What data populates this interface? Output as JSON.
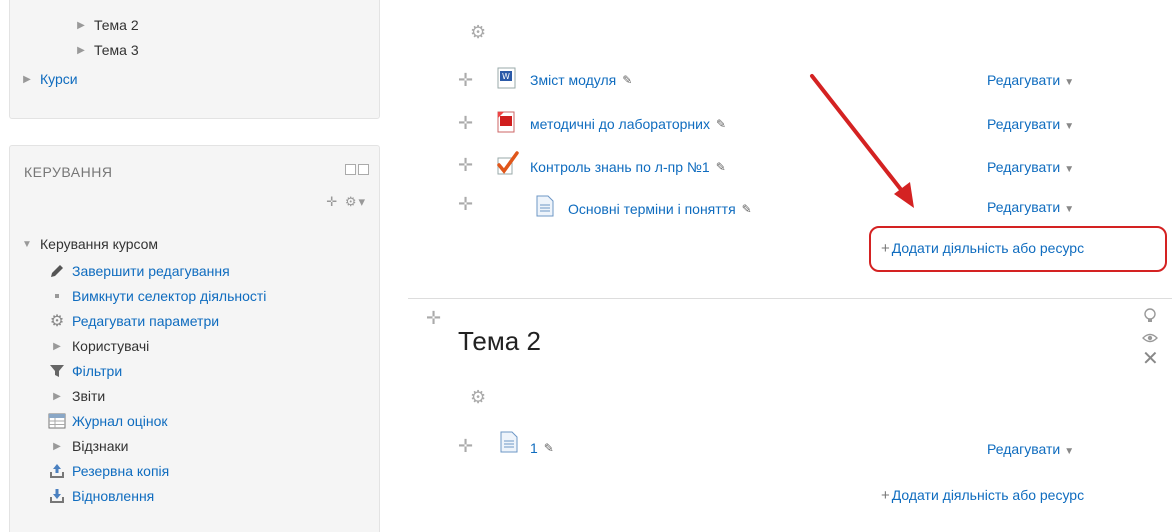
{
  "navigation": {
    "items": [
      {
        "label": "Тема 2"
      },
      {
        "label": "Тема 3"
      },
      {
        "label": "Курси"
      }
    ]
  },
  "admin": {
    "title": "КЕРУВАННЯ",
    "group_label": "Керування курсом",
    "items": [
      {
        "label": "Завершити редагування",
        "icon": "pencil-icon"
      },
      {
        "label": "Вимкнути селектор діяльності",
        "icon": "bullet-icon"
      },
      {
        "label": "Редагувати параметри",
        "icon": "gear-icon"
      },
      {
        "label": "Користувачі",
        "icon": "triangle-right-icon"
      },
      {
        "label": "Фільтри",
        "icon": "filter-icon"
      },
      {
        "label": "Звіти",
        "icon": "triangle-right-icon"
      },
      {
        "label": "Журнал оцінок",
        "icon": "gradebook-icon"
      },
      {
        "label": "Відзнаки",
        "icon": "triangle-right-icon"
      },
      {
        "label": "Резервна копія",
        "icon": "backup-icon"
      },
      {
        "label": "Відновлення",
        "icon": "restore-icon"
      }
    ]
  },
  "section1": {
    "activities": [
      {
        "name": "Зміст модуля",
        "icon": "word-doc-icon",
        "edit_label": "Редагувати"
      },
      {
        "name": "методичні до лабораторних",
        "icon": "pdf-icon",
        "edit_label": "Редагувати"
      },
      {
        "name": "Контроль знань по л-пр №1",
        "icon": "quiz-icon",
        "edit_label": "Редагувати"
      },
      {
        "name": "Основні терміни і поняття",
        "icon": "page-icon",
        "edit_label": "Редагувати"
      }
    ],
    "add_label": "Додати діяльність або ресурс"
  },
  "section2": {
    "title": "Тема 2",
    "activities": [
      {
        "name": "1",
        "icon": "page-icon",
        "edit_label": "Редагувати"
      }
    ],
    "add_label": "Додати діяльність або ресурс"
  },
  "colors": {
    "link": "#0f6cbf",
    "highlight": "#d42222",
    "block_bg": "#f5f5f5"
  }
}
